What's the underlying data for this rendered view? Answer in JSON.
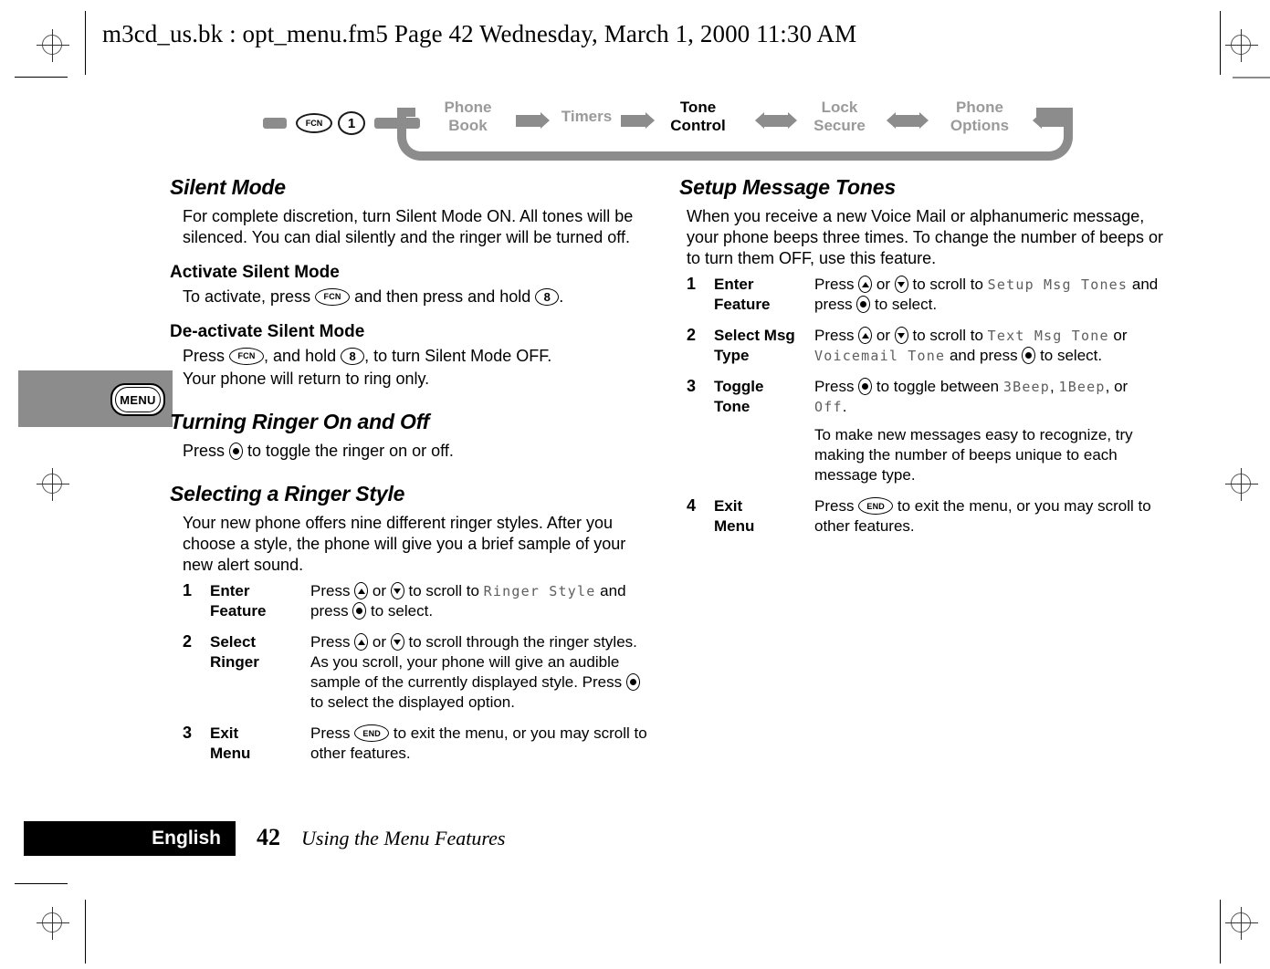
{
  "page_header": "m3cd_us.bk : opt_menu.fm5  Page 42  Wednesday, March 1, 2000  11:30 AM",
  "colors": {
    "nav_track": "#8c8c8c",
    "nav_inactive_text": "#9a9a9a",
    "nav_active_text": "#000000",
    "lcd_text": "#5e5e5e",
    "footer_bar": "#000000",
    "menu_tab": "#8c8c8c"
  },
  "navbar": {
    "prefix_keys": [
      "FCN",
      "1"
    ],
    "items": [
      {
        "label_line1": "Phone",
        "label_line2": "Book",
        "active": false
      },
      {
        "label_line1": "Timers",
        "label_line2": "",
        "active": false
      },
      {
        "label_line1": "Tone",
        "label_line2": "Control",
        "active": true
      },
      {
        "label_line1": "Lock",
        "label_line2": "Secure",
        "active": false
      },
      {
        "label_line1": "Phone",
        "label_line2": "Options",
        "active": false
      }
    ]
  },
  "menu_tab": {
    "label": "MENU"
  },
  "left_column": {
    "silent_mode": {
      "title": "Silent Mode",
      "intro": "For complete discretion, turn Silent Mode ON. All tones will be silenced. You can dial silently and the ringer will be turned off.",
      "activate": {
        "heading": "Activate Silent Mode",
        "text_a": "To activate, press",
        "key1": "FCN",
        "text_b": "and then press and hold",
        "key2": "8",
        "text_c": "."
      },
      "deactivate": {
        "heading": "De-activate Silent Mode",
        "text_a": "Press",
        "key1": "FCN",
        "text_b": ", and hold",
        "key2": "8",
        "text_c": ", to turn Silent Mode OFF.",
        "line2": "Your phone will return to ring only."
      }
    },
    "ringer_toggle": {
      "title": "Turning Ringer On and Off",
      "text_a": "Press",
      "key_select": "select",
      "text_b": "to toggle the ringer on or off."
    },
    "ringer_style": {
      "title": "Selecting a Ringer Style",
      "intro": "Your new phone offers nine different ringer styles. After you choose a style, the phone will give you a brief sample of your new alert sound.",
      "steps": [
        {
          "num": "1",
          "name_line1": "Enter",
          "name_line2": "Feature",
          "desc_parts": [
            {
              "t": "Press "
            },
            {
              "key": "up"
            },
            {
              "t": " or "
            },
            {
              "key": "down"
            },
            {
              "t": " to scroll to "
            },
            {
              "lcd": "Ringer Style"
            },
            {
              "t": " and press "
            },
            {
              "key": "select"
            },
            {
              "t": " to select."
            }
          ]
        },
        {
          "num": "2",
          "name_line1": "Select",
          "name_line2": "Ringer",
          "desc_parts": [
            {
              "t": "Press "
            },
            {
              "key": "up"
            },
            {
              "t": " or "
            },
            {
              "key": "down"
            },
            {
              "t": " to scroll through the ringer styles. As you scroll, your phone will give an audible sample of the currently displayed style. Press "
            },
            {
              "key": "select"
            },
            {
              "t": " to select the displayed option."
            }
          ]
        },
        {
          "num": "3",
          "name_line1": "Exit",
          "name_line2": "Menu",
          "desc_parts": [
            {
              "t": "Press "
            },
            {
              "key": "END"
            },
            {
              "t": " to exit the menu, or you may scroll to other features."
            }
          ]
        }
      ]
    }
  },
  "right_column": {
    "setup_message_tones": {
      "title": "Setup Message Tones",
      "intro": "When you receive a new Voice Mail or alphanumeric message, your phone beeps three times. To change the number of beeps or to turn them OFF, use this feature.",
      "steps": [
        {
          "num": "1",
          "name_line1": "Enter",
          "name_line2": "Feature",
          "desc_parts": [
            {
              "t": "Press "
            },
            {
              "key": "up"
            },
            {
              "t": " or "
            },
            {
              "key": "down"
            },
            {
              "t": " to scroll to "
            },
            {
              "lcd": "Setup Msg Tones"
            },
            {
              "t": " and press "
            },
            {
              "key": "select"
            },
            {
              "t": " to select."
            }
          ]
        },
        {
          "num": "2",
          "name_line1": "Select Msg",
          "name_line2": "Type",
          "desc_parts": [
            {
              "t": "Press "
            },
            {
              "key": "up"
            },
            {
              "t": " or "
            },
            {
              "key": "down"
            },
            {
              "t": " to scroll to "
            },
            {
              "lcd": "Text Msg Tone"
            },
            {
              "t": " or "
            },
            {
              "lcd": "Voicemail Tone"
            },
            {
              "t": " and press "
            },
            {
              "key": "select"
            },
            {
              "t": " to select."
            }
          ]
        },
        {
          "num": "3",
          "name_line1": "Toggle",
          "name_line2": "Tone",
          "desc_parts": [
            {
              "t": "Press "
            },
            {
              "key": "select"
            },
            {
              "t": " to toggle between "
            },
            {
              "lcd": "3Beep"
            },
            {
              "t": ", "
            },
            {
              "lcd": "1Beep"
            },
            {
              "t": ", or "
            },
            {
              "lcd": "Off"
            },
            {
              "t": "."
            },
            {
              "br": true
            },
            {
              "t": "To make new messages easy to recognize, try making the number of beeps unique to each message type."
            }
          ]
        },
        {
          "num": "4",
          "name_line1": "Exit",
          "name_line2": "Menu",
          "desc_parts": [
            {
              "t": "Press "
            },
            {
              "key": "END"
            },
            {
              "t": " to exit the menu, or you may scroll to other features."
            }
          ]
        }
      ]
    }
  },
  "footer": {
    "language": "English",
    "page_number": "42",
    "chapter": "Using the Menu Features"
  }
}
